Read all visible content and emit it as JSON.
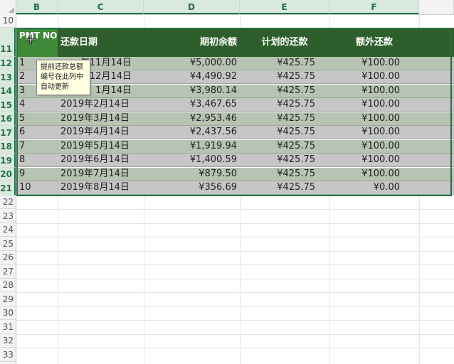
{
  "columns": [
    {
      "letter": "B"
    },
    {
      "letter": "C"
    },
    {
      "letter": "D"
    },
    {
      "letter": "E"
    },
    {
      "letter": "F"
    }
  ],
  "row_numbers": [
    "10",
    "11",
    "12",
    "13",
    "14",
    "15",
    "16",
    "17",
    "18",
    "19",
    "20",
    "21",
    "22",
    "23",
    "24",
    "25",
    "26",
    "27",
    "28",
    "29",
    "30",
    "31",
    "32",
    "33"
  ],
  "table": {
    "headers": {
      "pmt_no": "PMT NO",
      "date": "还款日期",
      "opening_balance": "期初余额",
      "scheduled_payment": "计划的还款",
      "extra_payment": "额外还款"
    },
    "rows": [
      {
        "no": "1",
        "date": "年11月14日",
        "balance": "¥5,000.00",
        "payment": "¥425.75",
        "extra": "¥100.00"
      },
      {
        "no": "2",
        "date": "年12月14日",
        "balance": "¥4,490.92",
        "payment": "¥425.75",
        "extra": "¥100.00"
      },
      {
        "no": "3",
        "date": "1月14日",
        "balance": "¥3,980.14",
        "payment": "¥425.75",
        "extra": "¥100.00"
      },
      {
        "no": "4",
        "date": "2019年2月14日",
        "balance": "¥3,467.65",
        "payment": "¥425.75",
        "extra": "¥100.00"
      },
      {
        "no": "5",
        "date": "2019年3月14日",
        "balance": "¥2,953.46",
        "payment": "¥425.75",
        "extra": "¥100.00"
      },
      {
        "no": "6",
        "date": "2019年4月14日",
        "balance": "¥2,437.56",
        "payment": "¥425.75",
        "extra": "¥100.00"
      },
      {
        "no": "7",
        "date": "2019年5月14日",
        "balance": "¥1,919.94",
        "payment": "¥425.75",
        "extra": "¥100.00"
      },
      {
        "no": "8",
        "date": "2019年6月14日",
        "balance": "¥1,400.59",
        "payment": "¥425.75",
        "extra": "¥100.00"
      },
      {
        "no": "9",
        "date": "2019年7月14日",
        "balance": "¥879.50",
        "payment": "¥425.75",
        "extra": "¥100.00"
      },
      {
        "no": "10",
        "date": "2019年8月14日",
        "balance": "¥356.69",
        "payment": "¥425.75",
        "extra": "¥0.00"
      }
    ]
  },
  "tooltip": {
    "line1": "提前还款总额",
    "line2": "编号在此列中",
    "line3": "自动更新"
  },
  "colors": {
    "header_bg": "#2e5e2b",
    "pmt_header_bg": "#3e8a39",
    "row_band_a": "#b7c4b3",
    "row_band_b": "#c6c6c6",
    "selection": "#217346",
    "tooltip_bg": "#ffffe1"
  },
  "icons": {
    "cursor": "move-cursor-icon"
  }
}
